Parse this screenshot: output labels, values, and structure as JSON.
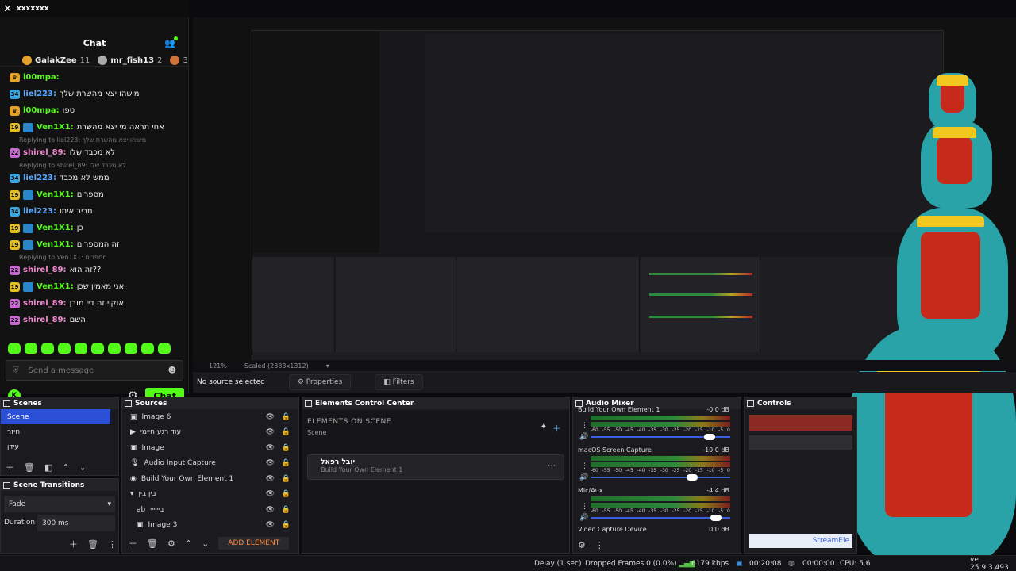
{
  "window": {
    "title": "xxxxxxx"
  },
  "chat": {
    "title": "Chat",
    "leaders": [
      {
        "name": "GalakZee",
        "count": "11",
        "color": "#e6a32b"
      },
      {
        "name": "mr_fish13",
        "count": "2",
        "color": "#aaaaaa"
      },
      {
        "name": "",
        "count": "3",
        "color": "#d0733a"
      }
    ],
    "messages": [
      {
        "kind": "msg",
        "level": "",
        "user": "l00mpa",
        "text": "",
        "color": "#53fc18",
        "lvlcolor": "#e6a32b"
      },
      {
        "kind": "msg",
        "level": "34",
        "user": "liel223",
        "text": "מישהו יצא מהשרת שלך",
        "color": "#5aa8ff",
        "lvlcolor": "#3aa7e0"
      },
      {
        "kind": "msg",
        "level": "",
        "user": "l00mpa",
        "text": "טפו",
        "color": "#53fc18",
        "lvlcolor": "#e6a32b"
      },
      {
        "kind": "msg",
        "level": "19",
        "user": "Ven1X1",
        "text": "אחי תראה מי יצא מהשרת",
        "color": "#53fc18",
        "lvlcolor": "#e0c020"
      },
      {
        "kind": "reply",
        "text": "Replying to liel223: מישהו יצא מהשרת שלך"
      },
      {
        "kind": "msg",
        "level": "22",
        "user": "shirel_89",
        "text": "לא מכבד שלו",
        "color": "#f08ad0",
        "lvlcolor": "#c86ad0"
      },
      {
        "kind": "reply",
        "text": "Replying to shirel_89: לא מכבד שלו"
      },
      {
        "kind": "msg",
        "level": "34",
        "user": "liel223",
        "text": "ממש לא מכבד",
        "color": "#5aa8ff",
        "lvlcolor": "#3aa7e0"
      },
      {
        "kind": "msg",
        "level": "19",
        "user": "Ven1X1",
        "text": "מספרים",
        "color": "#53fc18",
        "lvlcolor": "#e0c020"
      },
      {
        "kind": "msg",
        "level": "34",
        "user": "liel223",
        "text": "תריב איתו",
        "color": "#5aa8ff",
        "lvlcolor": "#3aa7e0"
      },
      {
        "kind": "msg",
        "level": "19",
        "user": "Ven1X1",
        "text": "כן",
        "color": "#53fc18",
        "lvlcolor": "#e0c020"
      },
      {
        "kind": "msg",
        "level": "19",
        "user": "Ven1X1",
        "text": "זה המספרים",
        "color": "#53fc18",
        "lvlcolor": "#e0c020"
      },
      {
        "kind": "reply",
        "text": "Replying to Ven1X1: מספרים"
      },
      {
        "kind": "msg",
        "level": "22",
        "user": "shirel_89",
        "text": "זה הוא??",
        "color": "#f08ad0",
        "lvlcolor": "#c86ad0"
      },
      {
        "kind": "msg",
        "level": "19",
        "user": "Ven1X1",
        "text": "אני מאמין שכן",
        "color": "#53fc18",
        "lvlcolor": "#e0c020"
      },
      {
        "kind": "msg",
        "level": "22",
        "user": "shirel_89",
        "text": "אוקיי זה דיי מובן",
        "color": "#f08ad0",
        "lvlcolor": "#c86ad0"
      },
      {
        "kind": "msg",
        "level": "22",
        "user": "shirel_89",
        "text": "השם",
        "color": "#f08ad0",
        "lvlcolor": "#c86ad0"
      }
    ],
    "send_placeholder": "Send a message",
    "chat_button": "Chat"
  },
  "preview": {
    "zoom": "121%",
    "scaled": "Scaled (2333x1312)",
    "no_source": "No source selected",
    "properties": "Properties",
    "filters": "Filters"
  },
  "scenes": {
    "title": "Scenes",
    "items": [
      "Scene",
      "חיזר",
      "עידן"
    ]
  },
  "transitions": {
    "title": "Scene Transitions",
    "selected": "Fade",
    "duration_label": "Duration",
    "duration_value": "300 ms"
  },
  "sources": {
    "title": "Sources",
    "items": [
      {
        "icon": "▣",
        "name": "Image 6",
        "indent": 0
      },
      {
        "icon": "▶",
        "name": "עוד רגע חיימי",
        "indent": 0
      },
      {
        "icon": "▣",
        "name": "Image",
        "indent": 0
      },
      {
        "icon": "🎙",
        "name": "Audio Input Capture",
        "indent": 0
      },
      {
        "icon": "◉",
        "name": "Build Your Own Element 1",
        "indent": 0
      },
      {
        "icon": "▾",
        "name": "בין בין",
        "indent": 0
      },
      {
        "icon": "ab",
        "name": "ביייייי",
        "indent": 1
      },
      {
        "icon": "▣",
        "name": "Image 3",
        "indent": 1
      }
    ],
    "add_element": "ADD ELEMENT"
  },
  "ecc": {
    "title": "Elements Control Center",
    "heading": "ELEMENTS ON SCENE",
    "sub": "Scene",
    "card_title": "יובל רפאל",
    "card_sub": "Build Your Own Element 1"
  },
  "mixer": {
    "title": "Audio Mixer",
    "channels": [
      {
        "name": "Build Your Own Element 1",
        "db": "-0.0 dB",
        "vol": 0.85
      },
      {
        "name": "macOS Screen Capture",
        "db": "-10.0 dB",
        "vol": 0.73
      },
      {
        "name": "Mic/Aux",
        "db": "-4.4 dB",
        "vol": 0.9
      }
    ],
    "ticks": [
      "-60",
      "-55",
      "-50",
      "-45",
      "-40",
      "-35",
      "-30",
      "-25",
      "-20",
      "-15",
      "-10",
      "-5",
      "0"
    ],
    "video_capture": "Video Capture Device",
    "video_db": "0.0 dB"
  },
  "controls": {
    "title": "Controls",
    "streamelements": "StreamEle"
  },
  "status": {
    "delay": "Delay (1 sec)",
    "dropped": "Dropped Frames 0 (0.0%)",
    "kbps": "6179 kbps",
    "rec_time": "00:20:08",
    "stream_time": "00:00:00",
    "cpu": "CPU: 5.6",
    "version": "ve 25.9.3.493"
  }
}
